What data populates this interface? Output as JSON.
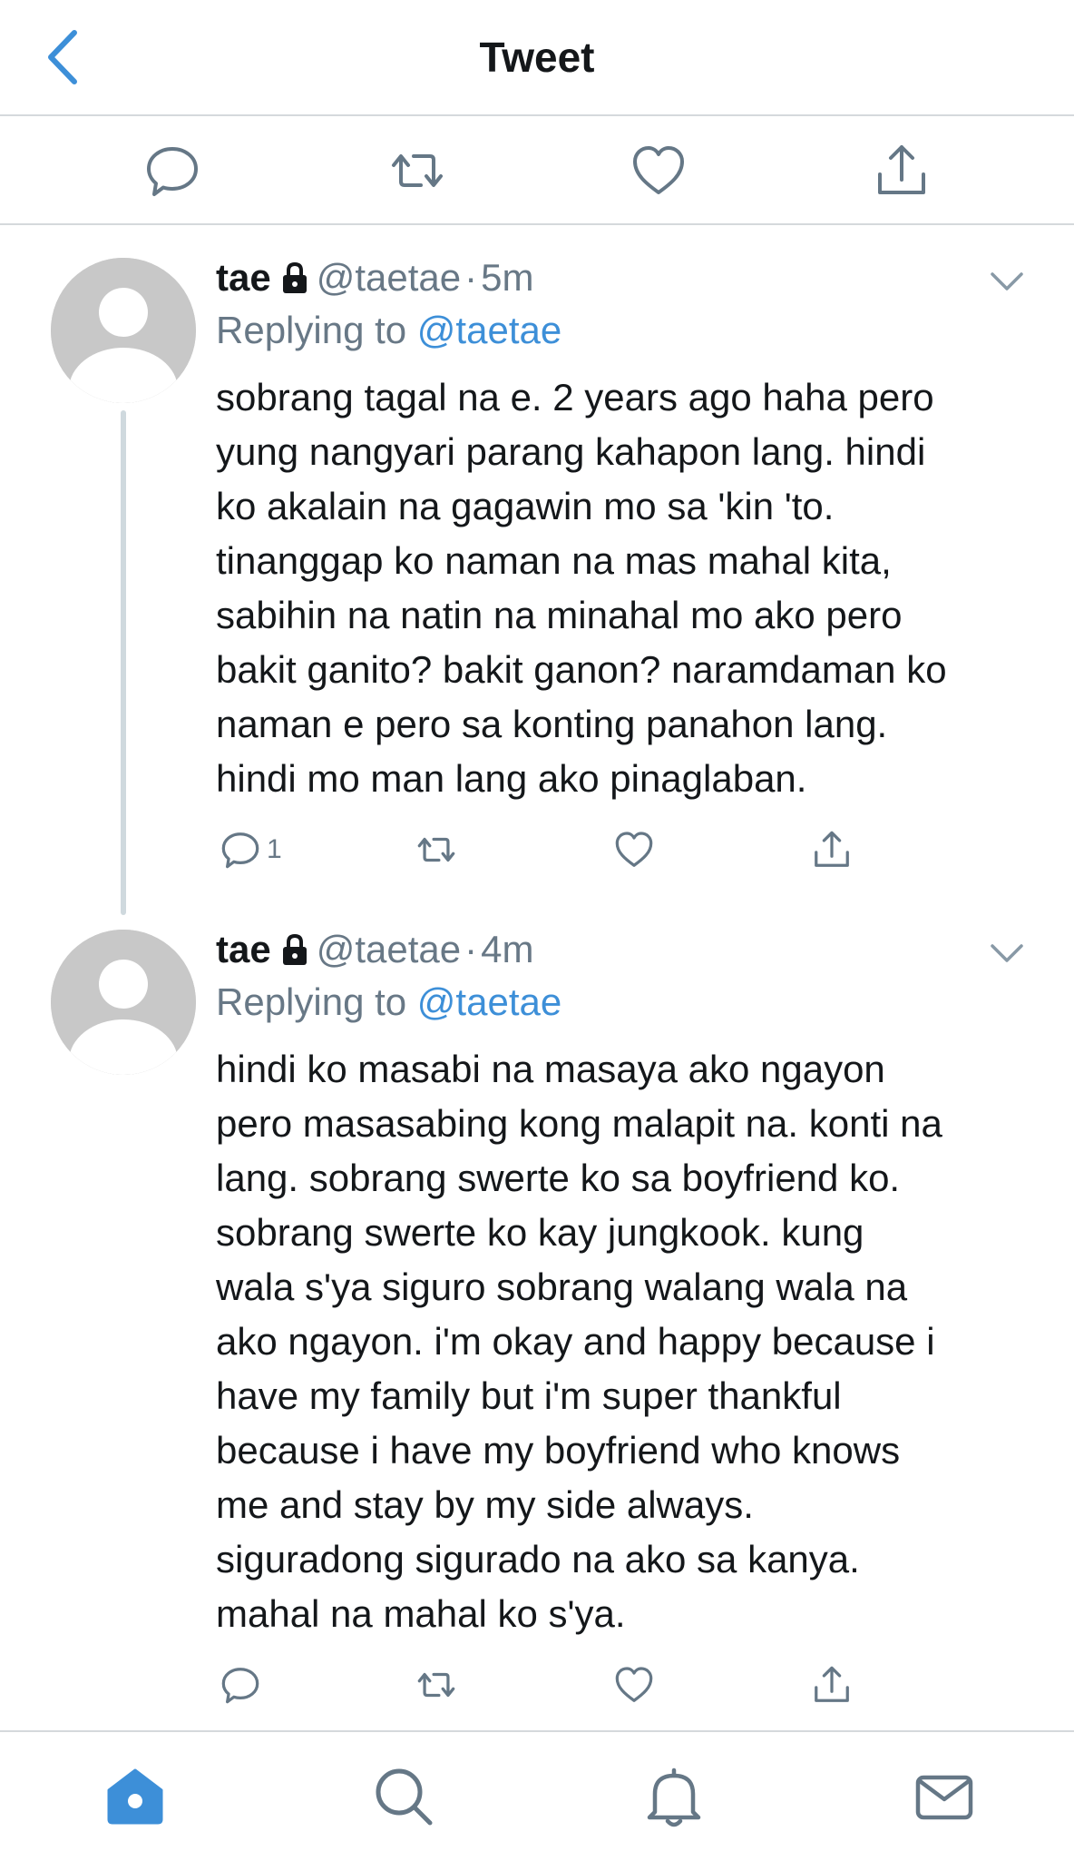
{
  "header": {
    "title": "Tweet",
    "back_icon": "chevron-left-icon"
  },
  "toolbar": {
    "icons": [
      "reply-icon",
      "retweet-icon",
      "like-icon",
      "share-icon"
    ]
  },
  "tweets": [
    {
      "name": "tae",
      "handle": "@taetae",
      "separator": "·",
      "time": "5m",
      "replying_prefix": "Replying to",
      "replying_to": "@taetae",
      "lines": [
        "sobrang tagal na e. 2 years ago haha pero",
        "yung nangyari parang kahapon lang. hindi",
        "ko akalain na gagawin mo sa 'kin 'to.",
        "tinanggap ko naman na mas mahal kita,",
        "sabihin na natin na minahal mo ako pero",
        "bakit ganito? bakit ganon? naramdaman ko",
        "naman e pero sa konting panahon lang.",
        "hindi mo man lang ako pinaglaban."
      ],
      "reply_count": "1"
    },
    {
      "name": "tae",
      "handle": "@taetae",
      "separator": "·",
      "time": "4m",
      "replying_prefix": "Replying to",
      "replying_to": "@taetae",
      "lines": [
        "hindi ko masabi na masaya ako ngayon",
        "pero masasabing kong malapit na. konti na",
        "lang. sobrang swerte ko sa boyfriend ko.",
        "sobrang swerte ko kay jungkook. kung",
        "wala s'ya siguro sobrang walang wala na",
        "ako ngayon. i'm okay and happy because i",
        "have my family but i'm super thankful",
        "because i have my boyfriend who knows",
        "me and stay by my side always.",
        "siguradong sigurado na ako sa kanya.",
        "mahal na mahal ko s'ya."
      ],
      "reply_count": ""
    }
  ],
  "tabbar": {
    "icons": [
      "home-icon",
      "search-icon",
      "notifications-icon",
      "messages-icon"
    ],
    "active_color": "#3d8fd8"
  },
  "colors": {
    "accent": "#3d8fd8",
    "muted": "#687886",
    "icon": "#657786"
  }
}
